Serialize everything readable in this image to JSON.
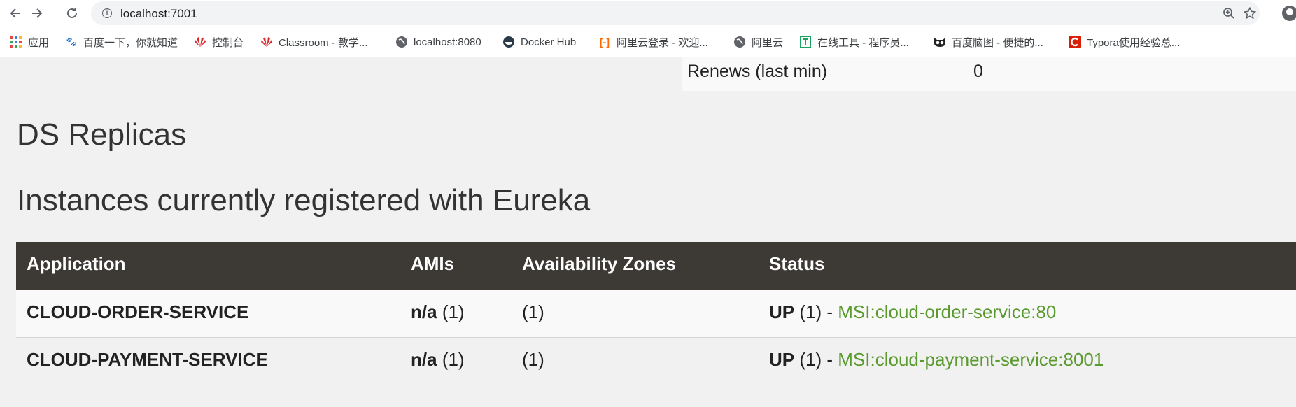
{
  "browser": {
    "url": "localhost:7001",
    "bookmarks": [
      {
        "label": "应用",
        "icon": "apps-grid-icon"
      },
      {
        "label": "百度一下，你就知道",
        "icon": "baidu-paw-icon",
        "color": "#2f6bdd"
      },
      {
        "label": "控制台",
        "icon": "huawei-icon",
        "color": "#e0262a"
      },
      {
        "label": "Classroom - 教学...",
        "icon": "huawei-icon",
        "color": "#e0262a"
      },
      {
        "label": "localhost:8080",
        "icon": "globe-icon",
        "color": "#5f6368"
      },
      {
        "label": "Docker Hub",
        "icon": "docker-icon",
        "color": "#2b3a4a"
      },
      {
        "label": "阿里云登录 - 欢迎...",
        "icon": "aliyun-icon",
        "color": "#ff6a00"
      },
      {
        "label": "阿里云",
        "icon": "globe-icon",
        "color": "#5f6368"
      },
      {
        "label": "在线工具 - 程序员...",
        "icon": "tool-icon",
        "color": "#1aa260"
      },
      {
        "label": "百度脑图 - 便捷的...",
        "icon": "owl-icon",
        "color": "#222222"
      },
      {
        "label": "Typora使用经验总...",
        "icon": "csdn-icon",
        "color": "#d81e06"
      }
    ]
  },
  "general_info": {
    "renews_label": "Renews (last min)",
    "renews_value": "0"
  },
  "headings": {
    "ds_replicas": "DS Replicas",
    "instances": "Instances currently registered with Eureka"
  },
  "instances_table": {
    "columns": [
      "Application",
      "AMIs",
      "Availability Zones",
      "Status"
    ],
    "rows": [
      {
        "application": "CLOUD-ORDER-SERVICE",
        "ami": "n/a",
        "ami_count": "(1)",
        "zones": "(1)",
        "status": "UP",
        "status_count": "(1) -",
        "instance_link": "MSI:cloud-order-service:80"
      },
      {
        "application": "CLOUD-PAYMENT-SERVICE",
        "ami": "n/a",
        "ami_count": "(1)",
        "zones": "(1)",
        "status": "UP",
        "status_count": "(1) -",
        "instance_link": "MSI:cloud-payment-service:8001"
      }
    ]
  },
  "colors": {
    "header_bg": "#3d3935",
    "link": "#5a9a2e",
    "page_bg": "#f1f1f1"
  }
}
